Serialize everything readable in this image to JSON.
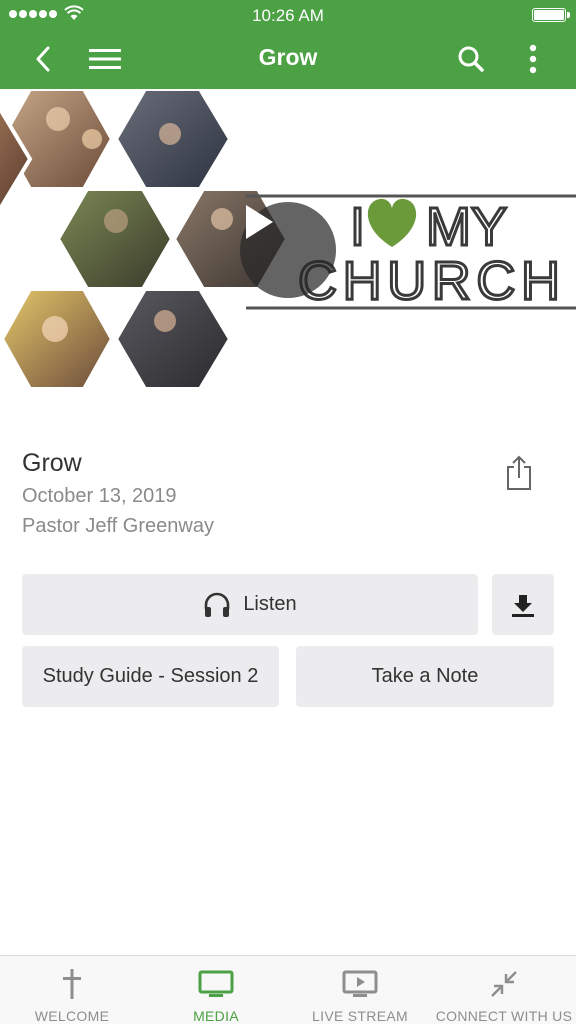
{
  "status_bar": {
    "time": "10:26 AM"
  },
  "app_bar": {
    "title": "Grow"
  },
  "hero": {
    "logo_text_line1": "MY",
    "logo_text_line2": "CHURCH",
    "logo_letter_i": "I",
    "heart_color": "#6a9a3a"
  },
  "sermon": {
    "title": "Grow",
    "date": "October 13, 2019",
    "speaker": "Pastor Jeff Greenway"
  },
  "actions": {
    "listen_label": "Listen",
    "study_guide_label": "Study Guide - Session 2",
    "take_note_label": "Take a Note"
  },
  "tabs": [
    {
      "label": "WELCOME",
      "icon": "cross-icon",
      "active": false
    },
    {
      "label": "MEDIA",
      "icon": "monitor-icon",
      "active": true
    },
    {
      "label": "LIVE STREAM",
      "icon": "play-screen-icon",
      "active": false
    },
    {
      "label": "CONNECT WITH US",
      "icon": "arrows-collapse-icon",
      "active": false
    }
  ],
  "colors": {
    "brand_green": "#4ba143",
    "button_gray": "#ececee",
    "text_gray": "#8a8a8a"
  }
}
